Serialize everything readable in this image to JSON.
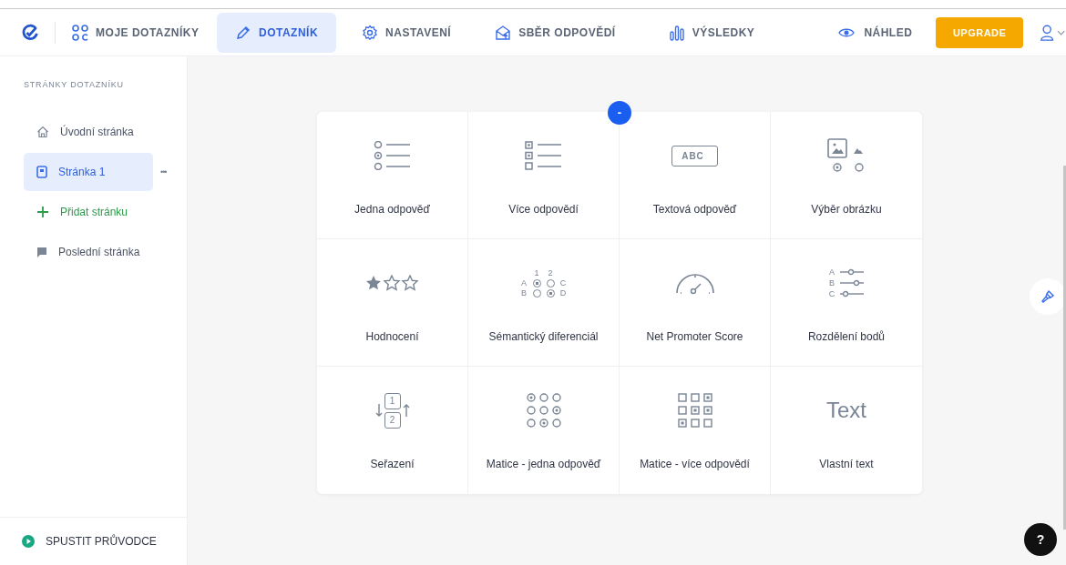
{
  "header": {
    "home_label": "MOJE DOTAZNÍKY",
    "tabs": [
      {
        "label": "DOTAZNÍK",
        "kind": "pencil",
        "selected": true
      },
      {
        "label": "NASTAVENÍ",
        "kind": "gear",
        "selected": false
      },
      {
        "label": "SBĚR ODPOVĚDÍ",
        "kind": "share",
        "selected": false
      },
      {
        "label": "VÝSLEDKY",
        "kind": "bars",
        "selected": false
      }
    ],
    "preview_label": "NÁHLED",
    "upgrade_label": "UPGRADE"
  },
  "sidebar": {
    "heading": "STRÁNKY DOTAZNÍKU",
    "items": [
      {
        "label": "Úvodní stránka",
        "kind": "home",
        "selected": false
      },
      {
        "label": "Stránka 1",
        "kind": "page",
        "selected": true
      },
      {
        "label": "Přidat stránku",
        "kind": "add",
        "selected": false
      },
      {
        "label": "Poslední stránka",
        "kind": "flag",
        "selected": false
      }
    ],
    "more_label": "•••",
    "tour_label": "SPUSTIT PRŮVODCE"
  },
  "collapse_label": "-",
  "question_types": [
    {
      "label": "Jedna odpověď",
      "kind": "single"
    },
    {
      "label": "Více odpovědí",
      "kind": "multi"
    },
    {
      "label": "Textová odpověď",
      "kind": "textinput",
      "icon_text": [
        "ABC"
      ]
    },
    {
      "label": "Výběr obrázku",
      "kind": "image"
    },
    {
      "label": "Hodnocení",
      "kind": "rating"
    },
    {
      "label": "Sémantický diferenciál",
      "kind": "semantic",
      "icon_text": [
        "1",
        "2",
        "A",
        "B",
        "C",
        "D"
      ]
    },
    {
      "label": "Net Promoter Score",
      "kind": "gauge"
    },
    {
      "label": "Rozdělení bodů",
      "kind": "points",
      "icon_text": [
        "A",
        "B",
        "C"
      ]
    },
    {
      "label": "Seřazení",
      "kind": "sort",
      "icon_text": [
        "1",
        "2"
      ]
    },
    {
      "label": "Matice - jedna odpověď",
      "kind": "matrix-single"
    },
    {
      "label": "Matice - více odpovědí",
      "kind": "matrix-multi"
    },
    {
      "label": "Vlastní text",
      "kind": "custom",
      "icon_text": [
        "Text"
      ]
    }
  ],
  "help_label": "?"
}
